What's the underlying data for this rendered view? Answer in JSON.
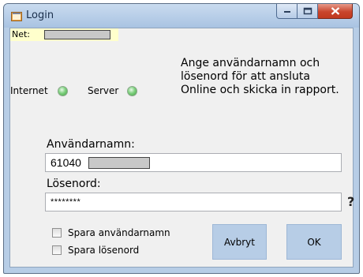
{
  "window": {
    "title": "Login"
  },
  "network": {
    "net_label": "Net:"
  },
  "status": {
    "internet_label": "Internet",
    "server_label": "Server"
  },
  "instructions": "Ange användarnamn och lösenord för att ansluta Online och skicka in rapport.",
  "form": {
    "username_label": "Användarnamn:",
    "username_value": "61040",
    "password_label": "Lösenord:",
    "password_value": "********",
    "help_mark": "?"
  },
  "options": {
    "save_username_label": "Spara användarnamn",
    "save_password_label": "Spara lösenord"
  },
  "buttons": {
    "cancel_label": "Avbryt",
    "ok_label": "OK"
  },
  "colors": {
    "status_ok": "#5ec45e",
    "button_bg": "#b7cde6",
    "close_button": "#c9452c"
  }
}
